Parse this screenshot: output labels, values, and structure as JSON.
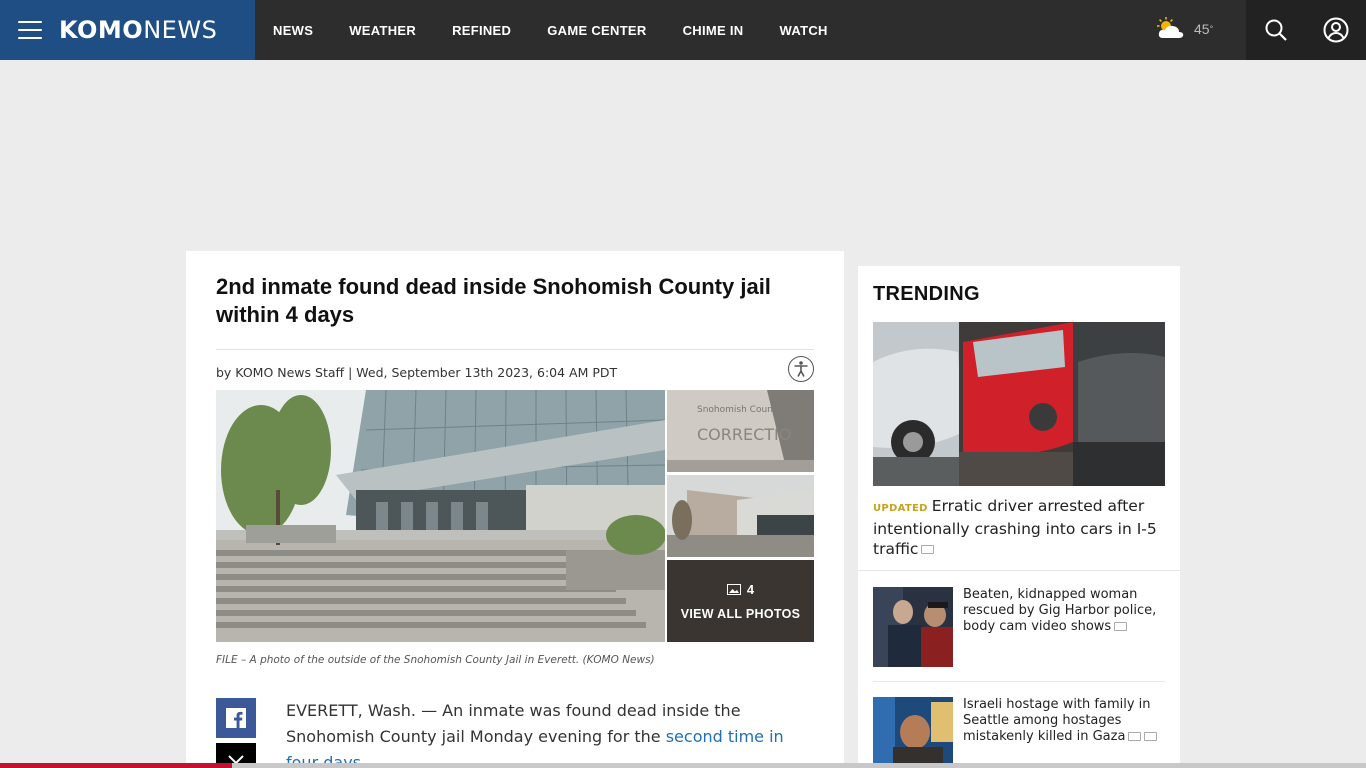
{
  "header": {
    "logo_bold": "KOMO",
    "logo_thin": "NEWS",
    "nav": [
      "NEWS",
      "WEATHER",
      "REFINED",
      "GAME CENTER",
      "CHIME IN",
      "WATCH"
    ],
    "temperature": "45",
    "degree": "°"
  },
  "article": {
    "headline": "2nd inmate found dead inside Snohomish County jail within 4 days",
    "byline": "by KOMO News Staff | Wed, September 13th 2023, 6:04 AM PDT",
    "photo_count": "4",
    "view_all": "VIEW ALL PHOTOS",
    "caption": "FILE – A photo of the outside of the Snohomish County Jail in Everett. (KOMO News)",
    "body_start": "EVERETT, Wash. — An inmate was found dead inside the Snohomish County jail Monday evening for the ",
    "body_link": "second time in four days.",
    "body_end": ""
  },
  "trending": {
    "title": "TRENDING",
    "lead_tag": "UPDATED",
    "lead_text": "Erratic driver arrested after intentionally crashing into cars in I-5 traffic",
    "stories": [
      {
        "text": "Beaten, kidnapped woman rescued by Gig Harbor police, body cam video shows"
      },
      {
        "text": "Israeli hostage with family in Seattle among hostages mistakenly killed in Gaza"
      }
    ]
  },
  "colors": {
    "brand": "#1f4e85",
    "topbar": "#2d2d2d",
    "link": "#1f6fb5",
    "tag": "#c9a21c",
    "progress": "#c8102e"
  },
  "reading_progress": 0.17
}
